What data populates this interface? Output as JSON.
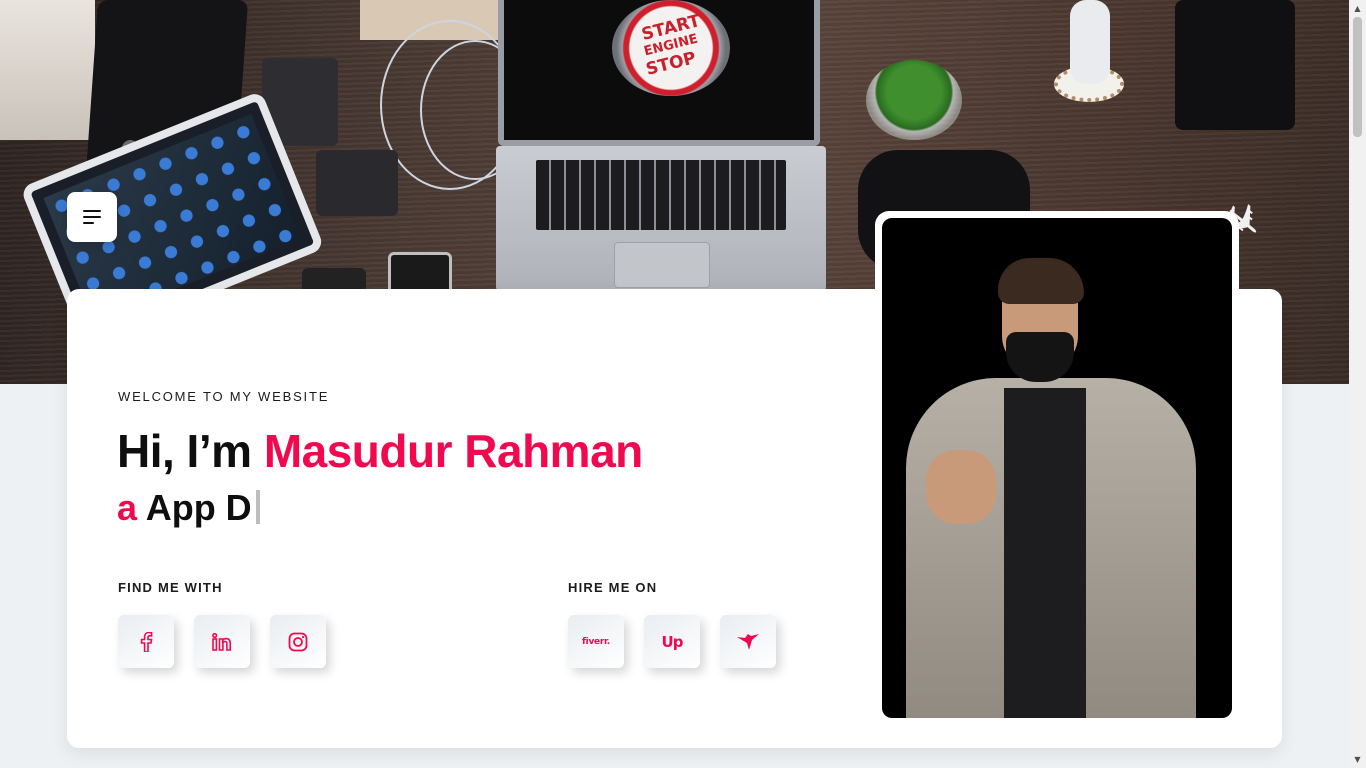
{
  "hero": {
    "background_image": "desk-workspace-photo",
    "laptop_screen_text": [
      "START",
      "ENGINE",
      "STOP"
    ]
  },
  "menu": {
    "icon": "hamburger-menu-icon"
  },
  "intro": {
    "eyebrow": "WELCOME TO MY WEBSITE",
    "greeting": "Hi, I’m ",
    "name": "Masudur Rahman",
    "typed_prefix": "a",
    "typed_text": "App D"
  },
  "find_me": {
    "title": "FIND ME WITH",
    "links": [
      {
        "name": "facebook",
        "icon": "facebook-icon"
      },
      {
        "name": "linkedin",
        "icon": "linkedin-icon"
      },
      {
        "name": "instagram",
        "icon": "instagram-icon"
      }
    ]
  },
  "hire_me": {
    "title": "HIRE ME ON",
    "links": [
      {
        "name": "fiverr",
        "label": "fiverr.",
        "icon": "fiverr-icon"
      },
      {
        "name": "upwork",
        "label": "Up",
        "icon": "upwork-icon"
      },
      {
        "name": "freelancer",
        "icon": "freelancer-bird-icon"
      }
    ]
  },
  "portrait": {
    "alt": "profile-photo"
  },
  "colors": {
    "accent": "#f0094f",
    "text": "#0e0e0e",
    "page_bg": "#eef1f4",
    "card_bg": "#ffffff"
  }
}
